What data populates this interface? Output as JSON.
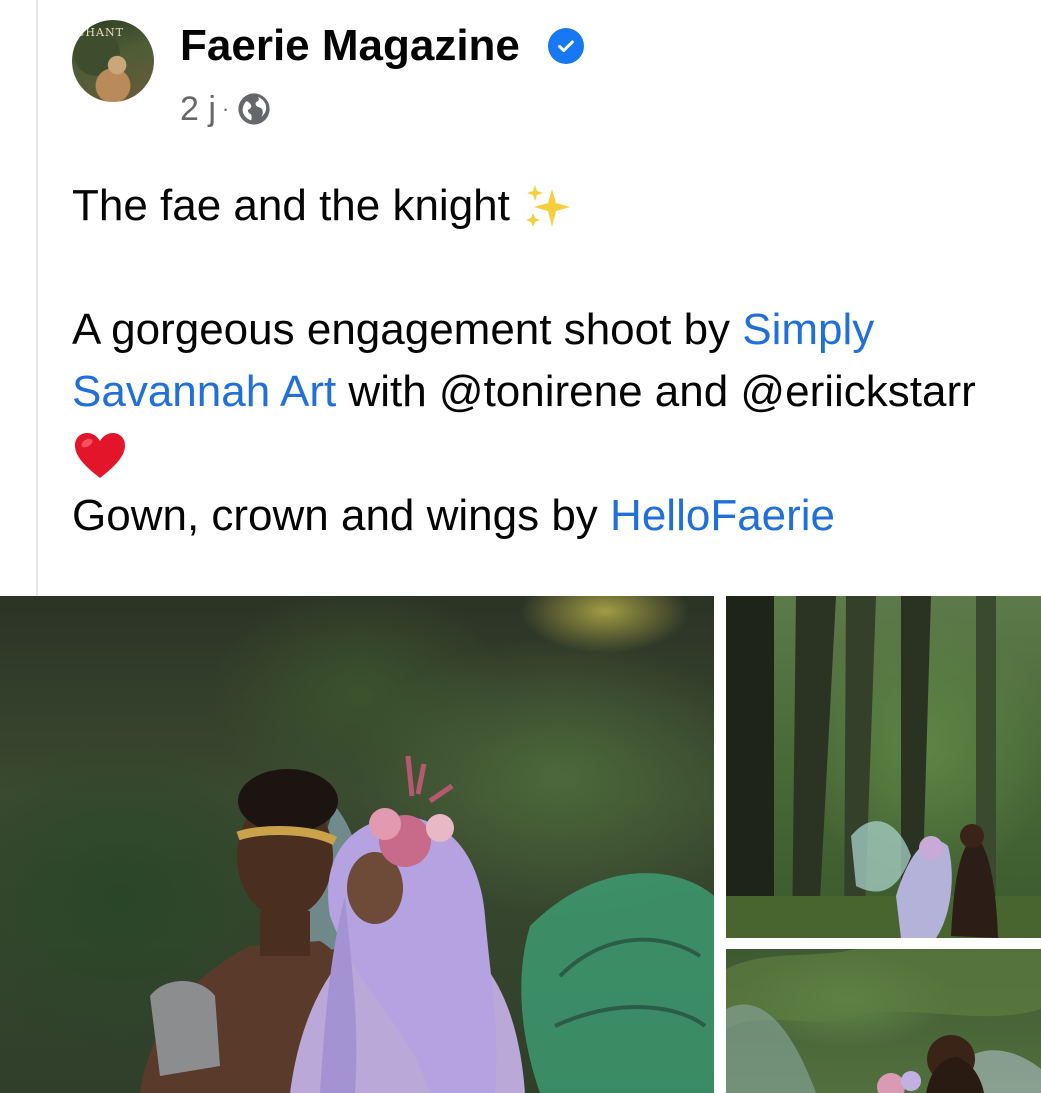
{
  "post": {
    "author": "Faerie Magazine",
    "avatar_text": "CHANT",
    "time": "2 j",
    "separator": "·",
    "line1": "The fae and the knight",
    "line2_start": "A gorgeous engagement shoot by ",
    "line2_link": "Simply Savannah Art",
    "line2_end": " with @tonirene and @eriickstarr",
    "line3_start": "Gown, crown and wings by ",
    "line3_link": "HelloFaerie"
  },
  "icons": {
    "verified": "verified-badge-icon",
    "audience": "globe-icon",
    "sparkles": "sparkles-emoji",
    "heart": "red-heart-emoji"
  },
  "colors": {
    "link": "#216fdb",
    "verified": "#1877f2",
    "meta": "#65676b",
    "text": "#050505"
  }
}
